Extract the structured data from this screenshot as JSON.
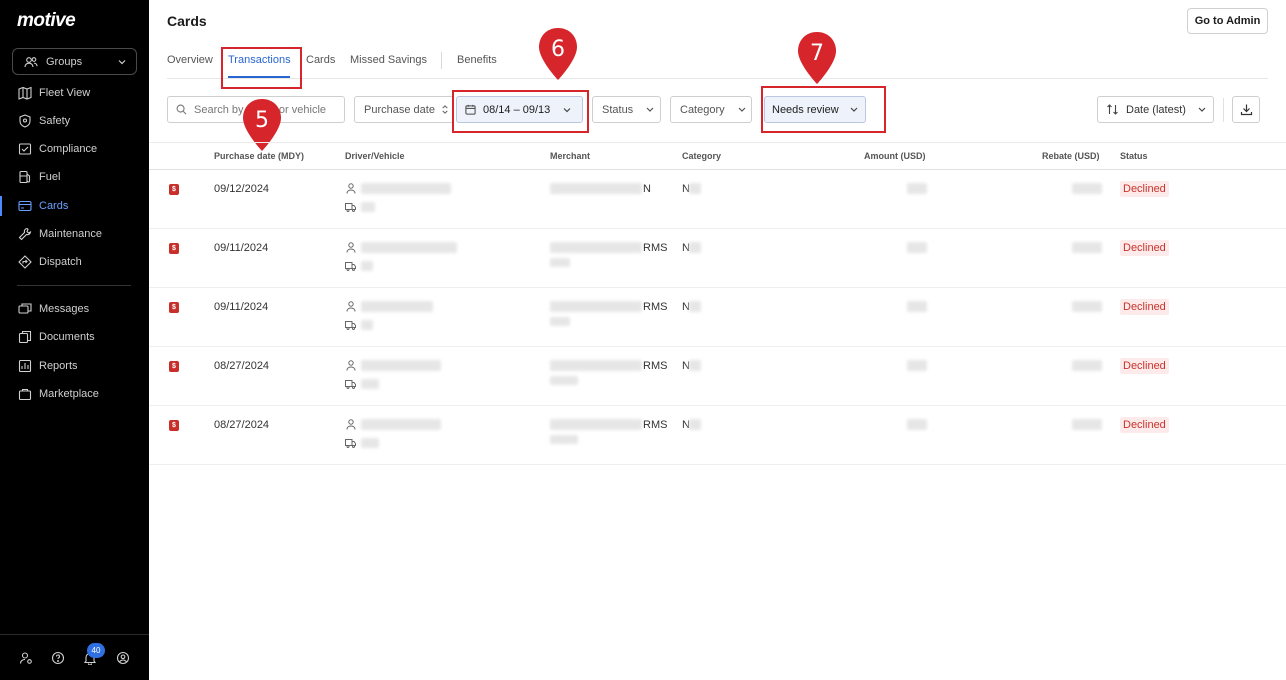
{
  "sidebar": {
    "logo": "motive",
    "groups_label": "Groups",
    "nav_top": [
      {
        "label": "Fleet View",
        "icon": "map-icon"
      },
      {
        "label": "Safety",
        "icon": "shield-icon"
      },
      {
        "label": "Compliance",
        "icon": "clipboard-icon"
      },
      {
        "label": "Fuel",
        "icon": "fuel-icon"
      },
      {
        "label": "Cards",
        "icon": "card-icon",
        "active": true
      },
      {
        "label": "Maintenance",
        "icon": "wrench-icon"
      },
      {
        "label": "Dispatch",
        "icon": "dispatch-icon"
      }
    ],
    "nav_bottom": [
      {
        "label": "Messages",
        "icon": "messages-icon"
      },
      {
        "label": "Documents",
        "icon": "documents-icon"
      },
      {
        "label": "Reports",
        "icon": "reports-icon"
      },
      {
        "label": "Marketplace",
        "icon": "marketplace-icon"
      }
    ],
    "notification_count": "40"
  },
  "header": {
    "title": "Cards",
    "admin_button": "Go to Admin"
  },
  "tabs": [
    "Overview",
    "Transactions",
    "Cards",
    "Missed Savings",
    "Benefits"
  ],
  "active_tab": "Transactions",
  "filters": {
    "search_placeholder_left": "Search by",
    "search_placeholder_right": "or vehicle",
    "purchase_date": "Purchase date",
    "date_range": "08/14 – 09/13",
    "status": "Status",
    "category": "Category",
    "needs_review": "Needs review",
    "sort": "Date (latest)"
  },
  "markers": [
    "5",
    "6",
    "7"
  ],
  "table": {
    "headers": [
      "Purchase date (MDY)",
      "Driver/Vehicle",
      "Merchant",
      "Category",
      "Amount (USD)",
      "Rebate (USD)",
      "Status"
    ],
    "rows": [
      {
        "date": "09/12/2024",
        "merchant_tail": "N",
        "category_tail": "N",
        "status": "Declined"
      },
      {
        "date": "09/11/2024",
        "merchant_tail": "RMS",
        "category_tail": "N",
        "status": "Declined"
      },
      {
        "date": "09/11/2024",
        "merchant_tail": "RMS",
        "category_tail": "N",
        "status": "Declined"
      },
      {
        "date": "08/27/2024",
        "merchant_tail": "RMS",
        "category_tail": "N",
        "status": "Declined"
      },
      {
        "date": "08/27/2024",
        "merchant_tail": "RMS",
        "category_tail": "N",
        "status": "Declined"
      }
    ]
  },
  "colors": {
    "accent": "#2866d1",
    "highlight": "#d6252b",
    "declined_text": "#c8332c",
    "declined_bg": "#fcebea"
  }
}
